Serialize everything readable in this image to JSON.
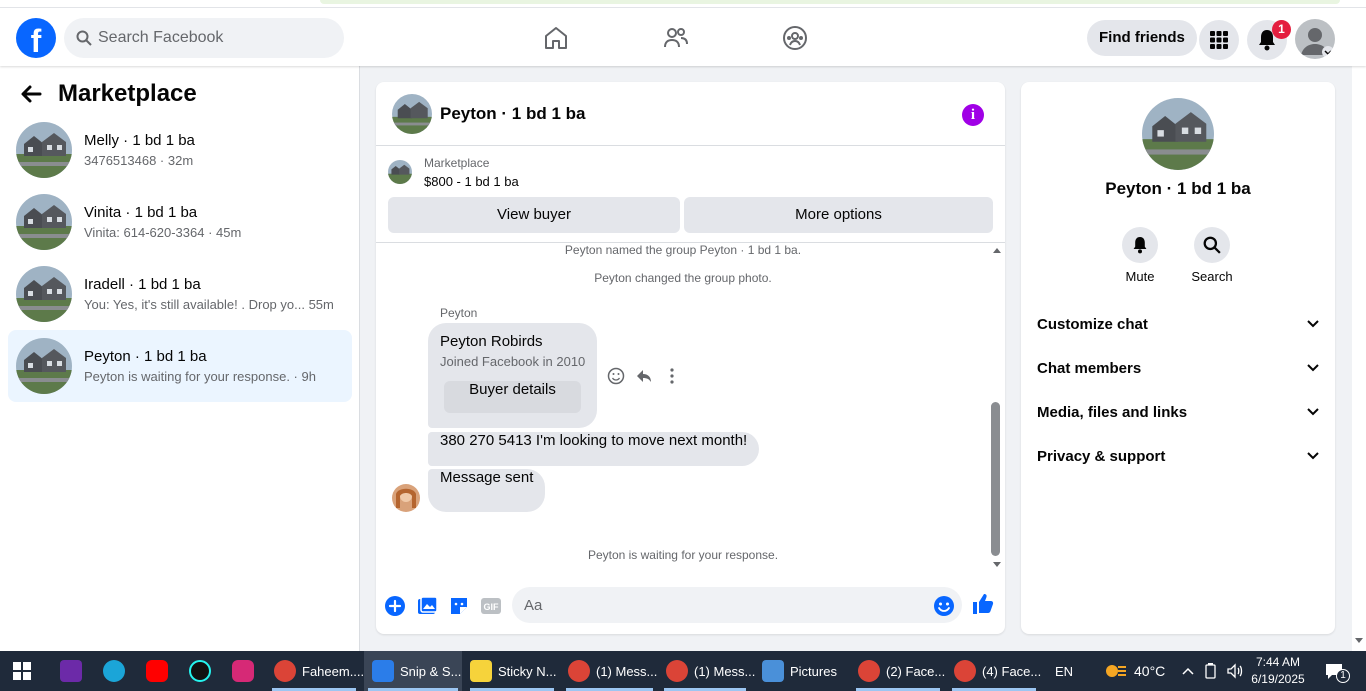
{
  "header": {
    "search_placeholder": "Search Facebook",
    "find_friends": "Find friends",
    "notifications_count": "1"
  },
  "sidebar": {
    "title": "Marketplace",
    "conversations": [
      {
        "name": "Melly · 1 bd 1 ba",
        "subtitle": "3476513468 · 32m"
      },
      {
        "name": "Vinita · 1 bd 1 ba",
        "subtitle": "Vinita: 614-620-3364 · 45m"
      },
      {
        "name": "Iradell · 1 bd 1 ba",
        "subtitle": "You: Yes, it's still available! . Drop yo...   55m"
      },
      {
        "name": "Peyton · 1 bd 1 ba",
        "subtitle": "Peyton is waiting for your response. · 9h"
      }
    ]
  },
  "chat": {
    "title": "Peyton · 1 bd 1 ba",
    "marketplace_label": "Marketplace",
    "listing": "$800 - 1 bd 1 ba",
    "view_buyer": "View buyer",
    "more_options": "More options",
    "system_1": "Peyton named the group Peyton · 1 bd 1 ba.",
    "system_2": "Peyton changed the group photo.",
    "sender": "Peyton",
    "card_name": "Peyton Robirds",
    "card_joined": "Joined Facebook in 2010",
    "buyer_details": "Buyer details",
    "message_1": "380 270 5413 I'm looking to move next month!",
    "message_2": "Message sent",
    "waiting": "Peyton is waiting for your response.",
    "composer_placeholder": "Aa"
  },
  "details": {
    "name": "Peyton · 1 bd 1 ba",
    "mute": "Mute",
    "search": "Search",
    "sections": [
      "Customize chat",
      "Chat members",
      "Media, files and links",
      "Privacy & support"
    ]
  },
  "taskbar": {
    "items": [
      "Faheem....",
      "Snip & S...",
      "Sticky N...",
      "(1) Mess...",
      "(1) Mess...",
      "Pictures",
      "(2) Face...",
      "(4) Face..."
    ],
    "lang": "EN",
    "temp": "40°C",
    "time": "7:44 AM",
    "date": "6/19/2025",
    "notif": "1"
  }
}
